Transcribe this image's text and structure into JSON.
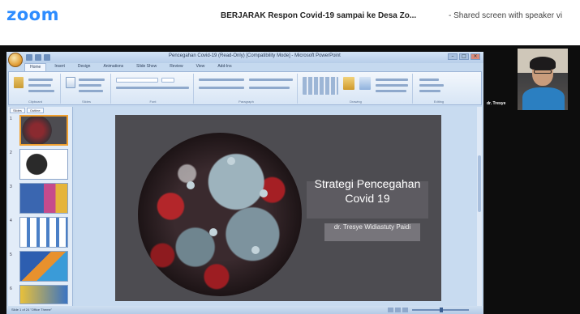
{
  "zoom_header": {
    "logo": "zoom",
    "meeting_title": "BERJARAK Respon Covid-19 sampai ke Desa Zo...",
    "share_status": "- Shared screen with speaker vi"
  },
  "powerpoint": {
    "window_title": "Pencegahan Covid-19 (Read-Only) [Compatibility Mode] - Microsoft PowerPoint",
    "ribbon_tabs": [
      "Home",
      "Insert",
      "Design",
      "Animations",
      "Slide Show",
      "Review",
      "View",
      "Add-Ins"
    ],
    "active_tab": "Home",
    "ribbon_groups": [
      "Clipboard",
      "Slides",
      "Font",
      "Paragraph",
      "Drawing",
      "Editing"
    ],
    "pane_tabs": [
      "Slides",
      "Outline"
    ],
    "thumbnail_numbers": [
      "1",
      "2",
      "3",
      "4",
      "5",
      "6"
    ],
    "status_text": "Slide 1 of 24    \"Office Theme\"",
    "window_controls": [
      "–",
      "□",
      "×"
    ]
  },
  "slide": {
    "title": "Strategi Pencegahan Covid 19",
    "subtitle": "dr. Tresye Widiastuty Paidi"
  },
  "speaker": {
    "name": "dr. Tresye"
  },
  "colors": {
    "zoom_blue": "#2d8cff",
    "ribbon_bg": "#dbe8f6",
    "slide_bg": "#4d4c51",
    "selected_thumb": "#f0a030"
  }
}
